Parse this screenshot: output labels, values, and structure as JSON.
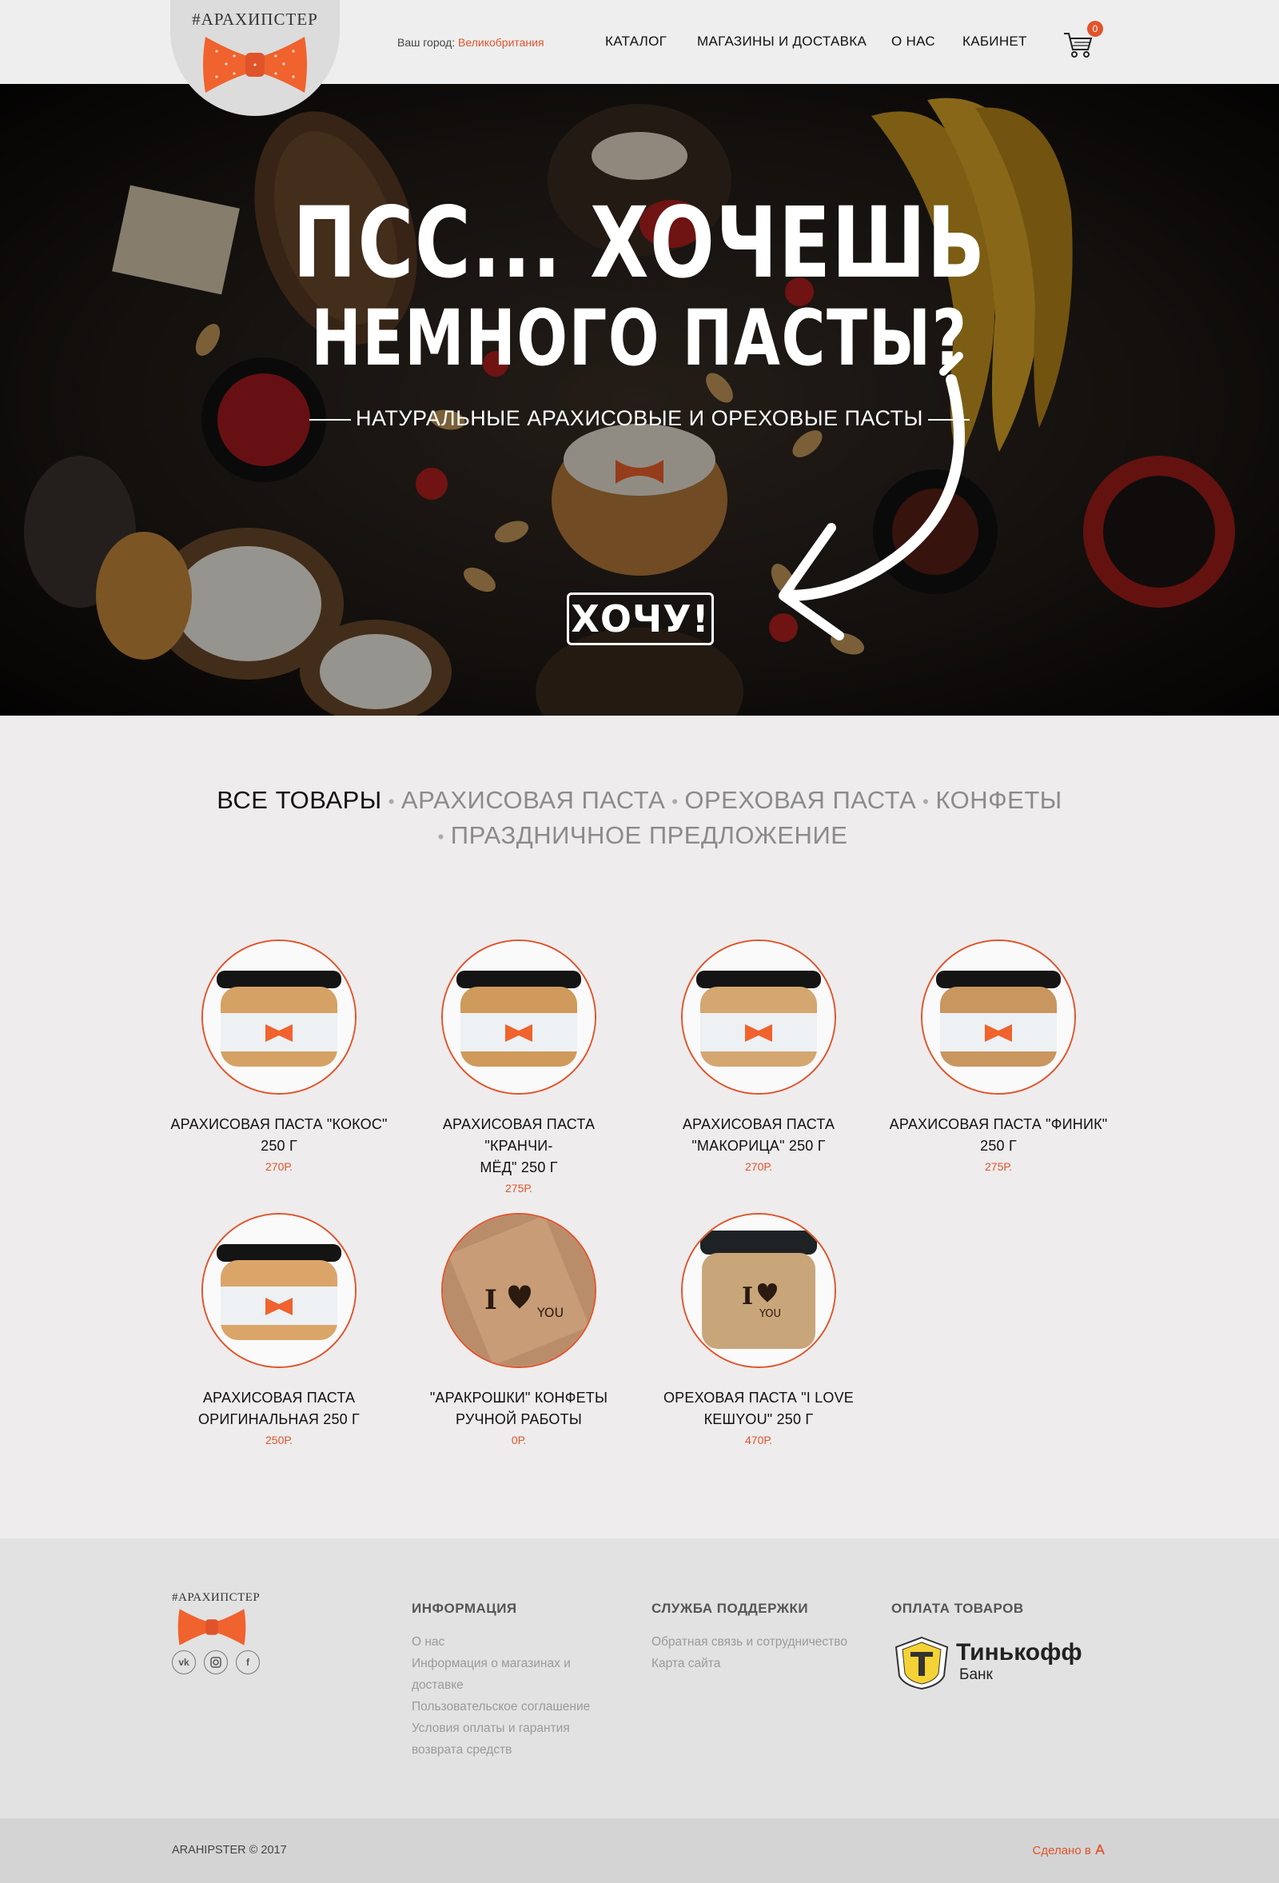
{
  "header": {
    "logo_text": "#АРАХИПСТЕР",
    "city_label": "Ваш город:",
    "city_name": "Великобритания",
    "nav": [
      "КАТАЛОГ",
      "МАГАЗИНЫ И ДОСТАВКА",
      "О НАС",
      "КАБИНЕТ"
    ],
    "cart_count": "0"
  },
  "hero": {
    "title_line1": "ПСС... ХОЧЕШЬ",
    "title_line2": "НЕМНОГО ПАСТЫ?",
    "subtitle": "НАТУРАЛЬНЫЕ АРАХИСОВЫЕ И ОРЕХОВЫЕ ПАСТЫ",
    "cta_label": "ХОЧУ!"
  },
  "categories": {
    "items": [
      "ВСЕ ТОВАРЫ",
      "АРАХИСОВАЯ ПАСТА",
      "ОРЕХОВАЯ ПАСТА",
      "КОНФЕТЫ",
      "ПРАЗДНИЧНОЕ ПРЕДЛОЖЕНИЕ"
    ],
    "active": "ВСЕ ТОВАРЫ"
  },
  "products": [
    {
      "name_line1": "АРАХИСОВАЯ ПАСТА \"КОКОС\"",
      "name_line2": "250 Г",
      "price": "270Р."
    },
    {
      "name_line1": "АРАХИСОВАЯ ПАСТА \"КРАНЧИ-",
      "name_line2": "МЁД\" 250 Г",
      "price": "275Р."
    },
    {
      "name_line1": "АРАХИСОВАЯ ПАСТА",
      "name_line2": "\"МАКОРИЦА\" 250 Г",
      "price": "270Р."
    },
    {
      "name_line1": "АРАХИСОВАЯ ПАСТА \"ФИНИК\"",
      "name_line2": "250 Г",
      "price": "275Р."
    },
    {
      "name_line1": "АРАХИСОВАЯ ПАСТА",
      "name_line2": "ОРИГИНАЛЬНАЯ 250 Г",
      "price": "250Р."
    },
    {
      "name_line1": "\"АРАКРОШКИ\" КОНФЕТЫ",
      "name_line2": "РУЧНОЙ РАБОТЫ",
      "price": "0Р."
    },
    {
      "name_line1": "ОРЕХОВАЯ ПАСТА \"I LOVE",
      "name_line2": "КЕШYOU\" 250 Г",
      "price": "470Р."
    }
  ],
  "footer": {
    "logo_text": "#АРАХИПСТЕР",
    "social": [
      "vk-icon",
      "instagram-icon",
      "facebook-icon"
    ],
    "info_title": "ИНФОРМАЦИЯ",
    "info_links": [
      "О нас",
      "Информация о магазинах и доставке",
      "Пользовательское соглашение",
      "Условия оплаты и гарантия возврата средств"
    ],
    "support_title": "СЛУЖБА ПОДДЕРЖКИ",
    "support_links": [
      "Обратная связь и сотрудничество",
      "Карта сайта"
    ],
    "payment_title": "ОПЛАТА ТОВАРОВ",
    "bank_name": "Тинькофф",
    "bank_sub": "Банк",
    "copyright": "ARAHIPSTER © 2017",
    "made_by": "Сделано в"
  },
  "colors": {
    "accent": "#e0542b",
    "bow": "#f0622e",
    "footer_bg": "#e2e2e2",
    "bottom_bg": "#d4d4d4"
  }
}
